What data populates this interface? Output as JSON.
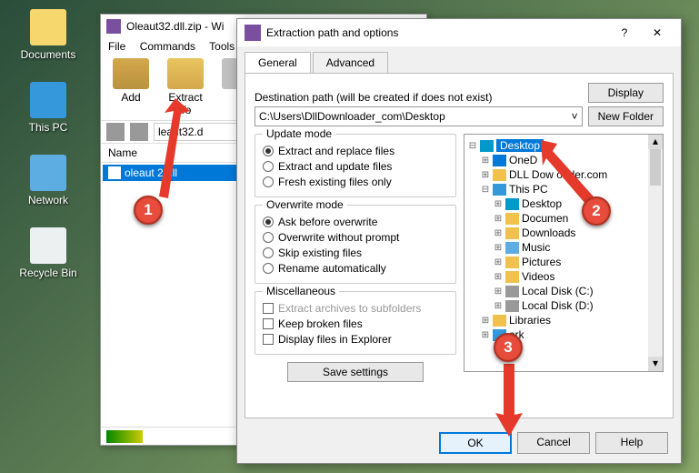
{
  "desktop": {
    "documents": "Documents",
    "thispc": "This PC",
    "network": "Network",
    "recyclebin": "Recycle Bin"
  },
  "winrar": {
    "title": "Oleaut32.dll.zip - Wi",
    "menu": {
      "file": "File",
      "commands": "Commands",
      "tools": "Tools"
    },
    "toolbar": {
      "add": "Add",
      "extract_to": "Extract To"
    },
    "address": "leaut32.d",
    "list_hdr": "Name",
    "file": "oleaut   2.dll"
  },
  "dialog": {
    "title": "Extraction path and options",
    "help_q": "?",
    "close_x": "✕",
    "tabs": {
      "general": "General",
      "advanced": "Advanced"
    },
    "dest_label": "Destination path (will be created if does not exist)",
    "dest_value": "C:\\Users\\DllDownloader_com\\Desktop",
    "btn_display": "Display",
    "btn_newfolder": "New Folder",
    "update": {
      "title": "Update mode",
      "r1": "Extract and replace files",
      "r2": "Extract and update files",
      "r3": "Fresh existing files only"
    },
    "overwrite": {
      "title": "Overwrite mode",
      "r1": "Ask before overwrite",
      "r2": "Overwrite without prompt",
      "r3": "Skip existing files",
      "r4": "Rename automatically"
    },
    "misc": {
      "title": "Miscellaneous",
      "c1": "Extract archives to subfolders",
      "c2": "Keep broken files",
      "c3": "Display files in Explorer"
    },
    "save_settings": "Save settings",
    "tree": {
      "desktop": "Desktop",
      "onedrive": "OneD",
      "dlldown": "DLL Dow     oader.com",
      "thispc": "This PC",
      "t_desktop": "Desktop",
      "t_docs": "Documen",
      "t_down": "Downloads",
      "t_music": "Music",
      "t_pics": "Pictures",
      "t_videos": "Videos",
      "t_c": "Local Disk (C:)",
      "t_d": "Local Disk (D:)",
      "libraries": "Libraries",
      "network": "ork"
    },
    "ok": "OK",
    "cancel": "Cancel",
    "help": "Help"
  },
  "markers": {
    "m1": "1",
    "m2": "2",
    "m3": "3"
  }
}
